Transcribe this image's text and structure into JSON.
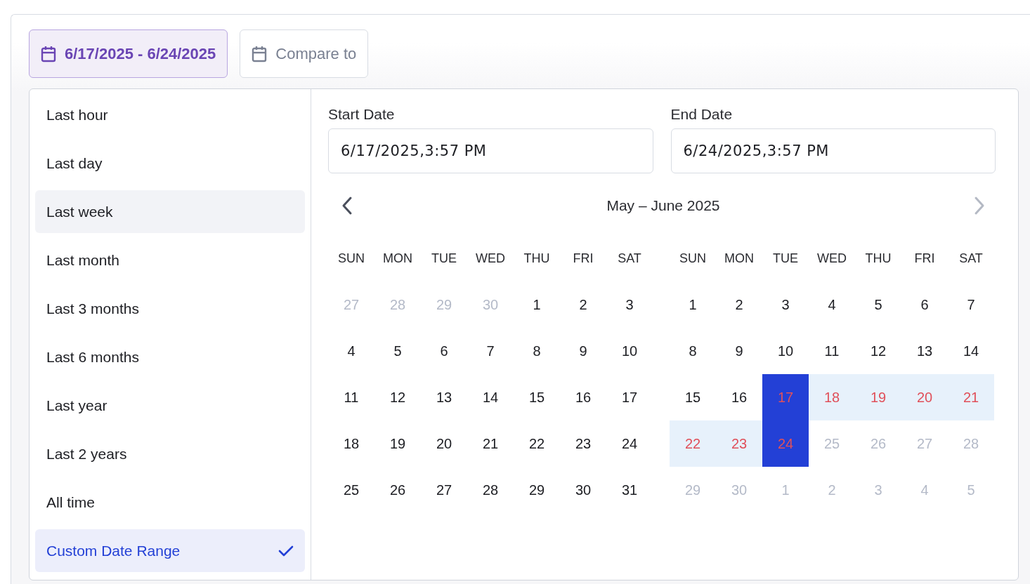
{
  "date_range_button": {
    "label": "6/17/2025 - 6/24/2025",
    "selected": true
  },
  "compare_button": {
    "label": "Compare to",
    "selected": false
  },
  "presets": [
    {
      "label": "Last hour",
      "selected": false,
      "hovered": false
    },
    {
      "label": "Last day",
      "selected": false,
      "hovered": false
    },
    {
      "label": "Last week",
      "selected": false,
      "hovered": true
    },
    {
      "label": "Last month",
      "selected": false,
      "hovered": false
    },
    {
      "label": "Last 3 months",
      "selected": false,
      "hovered": false
    },
    {
      "label": "Last 6 months",
      "selected": false,
      "hovered": false
    },
    {
      "label": "Last year",
      "selected": false,
      "hovered": false
    },
    {
      "label": "Last 2 years",
      "selected": false,
      "hovered": false
    },
    {
      "label": "All time",
      "selected": false,
      "hovered": false
    },
    {
      "label": "Custom Date Range",
      "selected": true,
      "hovered": false
    }
  ],
  "start_date": {
    "label": "Start Date",
    "value": "6/17/2025,3:57 PM"
  },
  "end_date": {
    "label": "End Date",
    "value": "6/24/2025,3:57 PM"
  },
  "calendar": {
    "title": "May – June 2025",
    "prev_disabled": false,
    "next_disabled": true,
    "months": [
      {
        "weekdays": [
          "SUN",
          "MON",
          "TUE",
          "WED",
          "THU",
          "FRI",
          "SAT"
        ],
        "weeks": [
          [
            {
              "day": "27",
              "kind": "outside"
            },
            {
              "day": "28",
              "kind": "outside"
            },
            {
              "day": "29",
              "kind": "outside"
            },
            {
              "day": "30",
              "kind": "outside"
            },
            {
              "day": "1",
              "kind": "current"
            },
            {
              "day": "2",
              "kind": "current"
            },
            {
              "day": "3",
              "kind": "current"
            }
          ],
          [
            {
              "day": "4",
              "kind": "current"
            },
            {
              "day": "5",
              "kind": "current"
            },
            {
              "day": "6",
              "kind": "current"
            },
            {
              "day": "7",
              "kind": "current"
            },
            {
              "day": "8",
              "kind": "current"
            },
            {
              "day": "9",
              "kind": "current"
            },
            {
              "day": "10",
              "kind": "current"
            }
          ],
          [
            {
              "day": "11",
              "kind": "current"
            },
            {
              "day": "12",
              "kind": "current"
            },
            {
              "day": "13",
              "kind": "current"
            },
            {
              "day": "14",
              "kind": "current"
            },
            {
              "day": "15",
              "kind": "current"
            },
            {
              "day": "16",
              "kind": "current"
            },
            {
              "day": "17",
              "kind": "current"
            }
          ],
          [
            {
              "day": "18",
              "kind": "current"
            },
            {
              "day": "19",
              "kind": "current"
            },
            {
              "day": "20",
              "kind": "current"
            },
            {
              "day": "21",
              "kind": "current"
            },
            {
              "day": "22",
              "kind": "current"
            },
            {
              "day": "23",
              "kind": "current"
            },
            {
              "day": "24",
              "kind": "current"
            }
          ],
          [
            {
              "day": "25",
              "kind": "current"
            },
            {
              "day": "26",
              "kind": "current"
            },
            {
              "day": "27",
              "kind": "current"
            },
            {
              "day": "28",
              "kind": "current"
            },
            {
              "day": "29",
              "kind": "current"
            },
            {
              "day": "30",
              "kind": "current"
            },
            {
              "day": "31",
              "kind": "current"
            }
          ]
        ]
      },
      {
        "weekdays": [
          "SUN",
          "MON",
          "TUE",
          "WED",
          "THU",
          "FRI",
          "SAT"
        ],
        "weeks": [
          [
            {
              "day": "1",
              "kind": "current"
            },
            {
              "day": "2",
              "kind": "current"
            },
            {
              "day": "3",
              "kind": "current"
            },
            {
              "day": "4",
              "kind": "current"
            },
            {
              "day": "5",
              "kind": "current"
            },
            {
              "day": "6",
              "kind": "current"
            },
            {
              "day": "7",
              "kind": "current"
            }
          ],
          [
            {
              "day": "8",
              "kind": "current"
            },
            {
              "day": "9",
              "kind": "current"
            },
            {
              "day": "10",
              "kind": "current"
            },
            {
              "day": "11",
              "kind": "current"
            },
            {
              "day": "12",
              "kind": "current"
            },
            {
              "day": "13",
              "kind": "current"
            },
            {
              "day": "14",
              "kind": "current"
            }
          ],
          [
            {
              "day": "15",
              "kind": "current"
            },
            {
              "day": "16",
              "kind": "current"
            },
            {
              "day": "17",
              "kind": "endpoint"
            },
            {
              "day": "18",
              "kind": "range"
            },
            {
              "day": "19",
              "kind": "range"
            },
            {
              "day": "20",
              "kind": "range"
            },
            {
              "day": "21",
              "kind": "range"
            }
          ],
          [
            {
              "day": "22",
              "kind": "range"
            },
            {
              "day": "23",
              "kind": "range"
            },
            {
              "day": "24",
              "kind": "endpoint"
            },
            {
              "day": "25",
              "kind": "outside"
            },
            {
              "day": "26",
              "kind": "outside"
            },
            {
              "day": "27",
              "kind": "outside"
            },
            {
              "day": "28",
              "kind": "outside"
            }
          ],
          [
            {
              "day": "29",
              "kind": "outside"
            },
            {
              "day": "30",
              "kind": "outside"
            },
            {
              "day": "1",
              "kind": "outside"
            },
            {
              "day": "2",
              "kind": "outside"
            },
            {
              "day": "3",
              "kind": "outside"
            },
            {
              "day": "4",
              "kind": "outside"
            },
            {
              "day": "5",
              "kind": "outside"
            }
          ]
        ]
      }
    ]
  }
}
